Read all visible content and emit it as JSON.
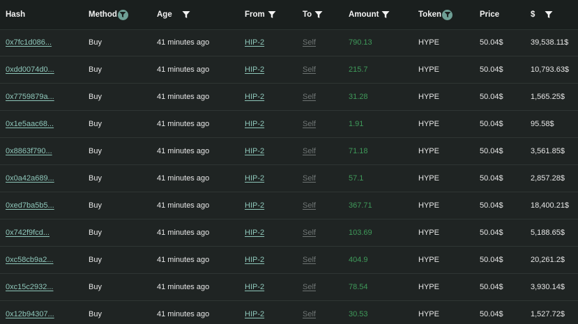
{
  "columns": {
    "hash": "Hash",
    "method": "Method",
    "age": "Age",
    "from": "From",
    "to": "To",
    "amount": "Amount",
    "token": "Token",
    "price": "Price",
    "usd": "$"
  },
  "colors": {
    "header_bg": "#1a1f1e",
    "body_bg": "#1f2423",
    "link": "#8fc8bb",
    "muted_link": "#6f7574",
    "amount_green": "#3f9a5a",
    "filter_badge": "#6e9f95"
  },
  "rows": [
    {
      "hash": "0x7fc1d086...",
      "method": "Buy",
      "age": "41 minutes ago",
      "from": "HIP-2",
      "to": "Self",
      "amount": "790.13",
      "token": "HYPE",
      "price": "50.04$",
      "usd": "39,538.11$"
    },
    {
      "hash": "0xdd0074d0...",
      "method": "Buy",
      "age": "41 minutes ago",
      "from": "HIP-2",
      "to": "Self",
      "amount": "215.7",
      "token": "HYPE",
      "price": "50.04$",
      "usd": "10,793.63$"
    },
    {
      "hash": "0x7759879a...",
      "method": "Buy",
      "age": "41 minutes ago",
      "from": "HIP-2",
      "to": "Self",
      "amount": "31.28",
      "token": "HYPE",
      "price": "50.04$",
      "usd": "1,565.25$"
    },
    {
      "hash": "0x1e5aac68...",
      "method": "Buy",
      "age": "41 minutes ago",
      "from": "HIP-2",
      "to": "Self",
      "amount": "1.91",
      "token": "HYPE",
      "price": "50.04$",
      "usd": "95.58$"
    },
    {
      "hash": "0x8863f790...",
      "method": "Buy",
      "age": "41 minutes ago",
      "from": "HIP-2",
      "to": "Self",
      "amount": "71.18",
      "token": "HYPE",
      "price": "50.04$",
      "usd": "3,561.85$"
    },
    {
      "hash": "0x0a42a689...",
      "method": "Buy",
      "age": "41 minutes ago",
      "from": "HIP-2",
      "to": "Self",
      "amount": "57.1",
      "token": "HYPE",
      "price": "50.04$",
      "usd": "2,857.28$"
    },
    {
      "hash": "0xed7ba5b5...",
      "method": "Buy",
      "age": "41 minutes ago",
      "from": "HIP-2",
      "to": "Self",
      "amount": "367.71",
      "token": "HYPE",
      "price": "50.04$",
      "usd": "18,400.21$"
    },
    {
      "hash": "0x742f9fcd...",
      "method": "Buy",
      "age": "41 minutes ago",
      "from": "HIP-2",
      "to": "Self",
      "amount": "103.69",
      "token": "HYPE",
      "price": "50.04$",
      "usd": "5,188.65$"
    },
    {
      "hash": "0xc58cb9a2...",
      "method": "Buy",
      "age": "41 minutes ago",
      "from": "HIP-2",
      "to": "Self",
      "amount": "404.9",
      "token": "HYPE",
      "price": "50.04$",
      "usd": "20,261.2$"
    },
    {
      "hash": "0xc15c2932...",
      "method": "Buy",
      "age": "41 minutes ago",
      "from": "HIP-2",
      "to": "Self",
      "amount": "78.54",
      "token": "HYPE",
      "price": "50.04$",
      "usd": "3,930.14$"
    },
    {
      "hash": "0x12b94307...",
      "method": "Buy",
      "age": "41 minutes ago",
      "from": "HIP-2",
      "to": "Self",
      "amount": "30.53",
      "token": "HYPE",
      "price": "50.04$",
      "usd": "1,527.72$"
    }
  ]
}
